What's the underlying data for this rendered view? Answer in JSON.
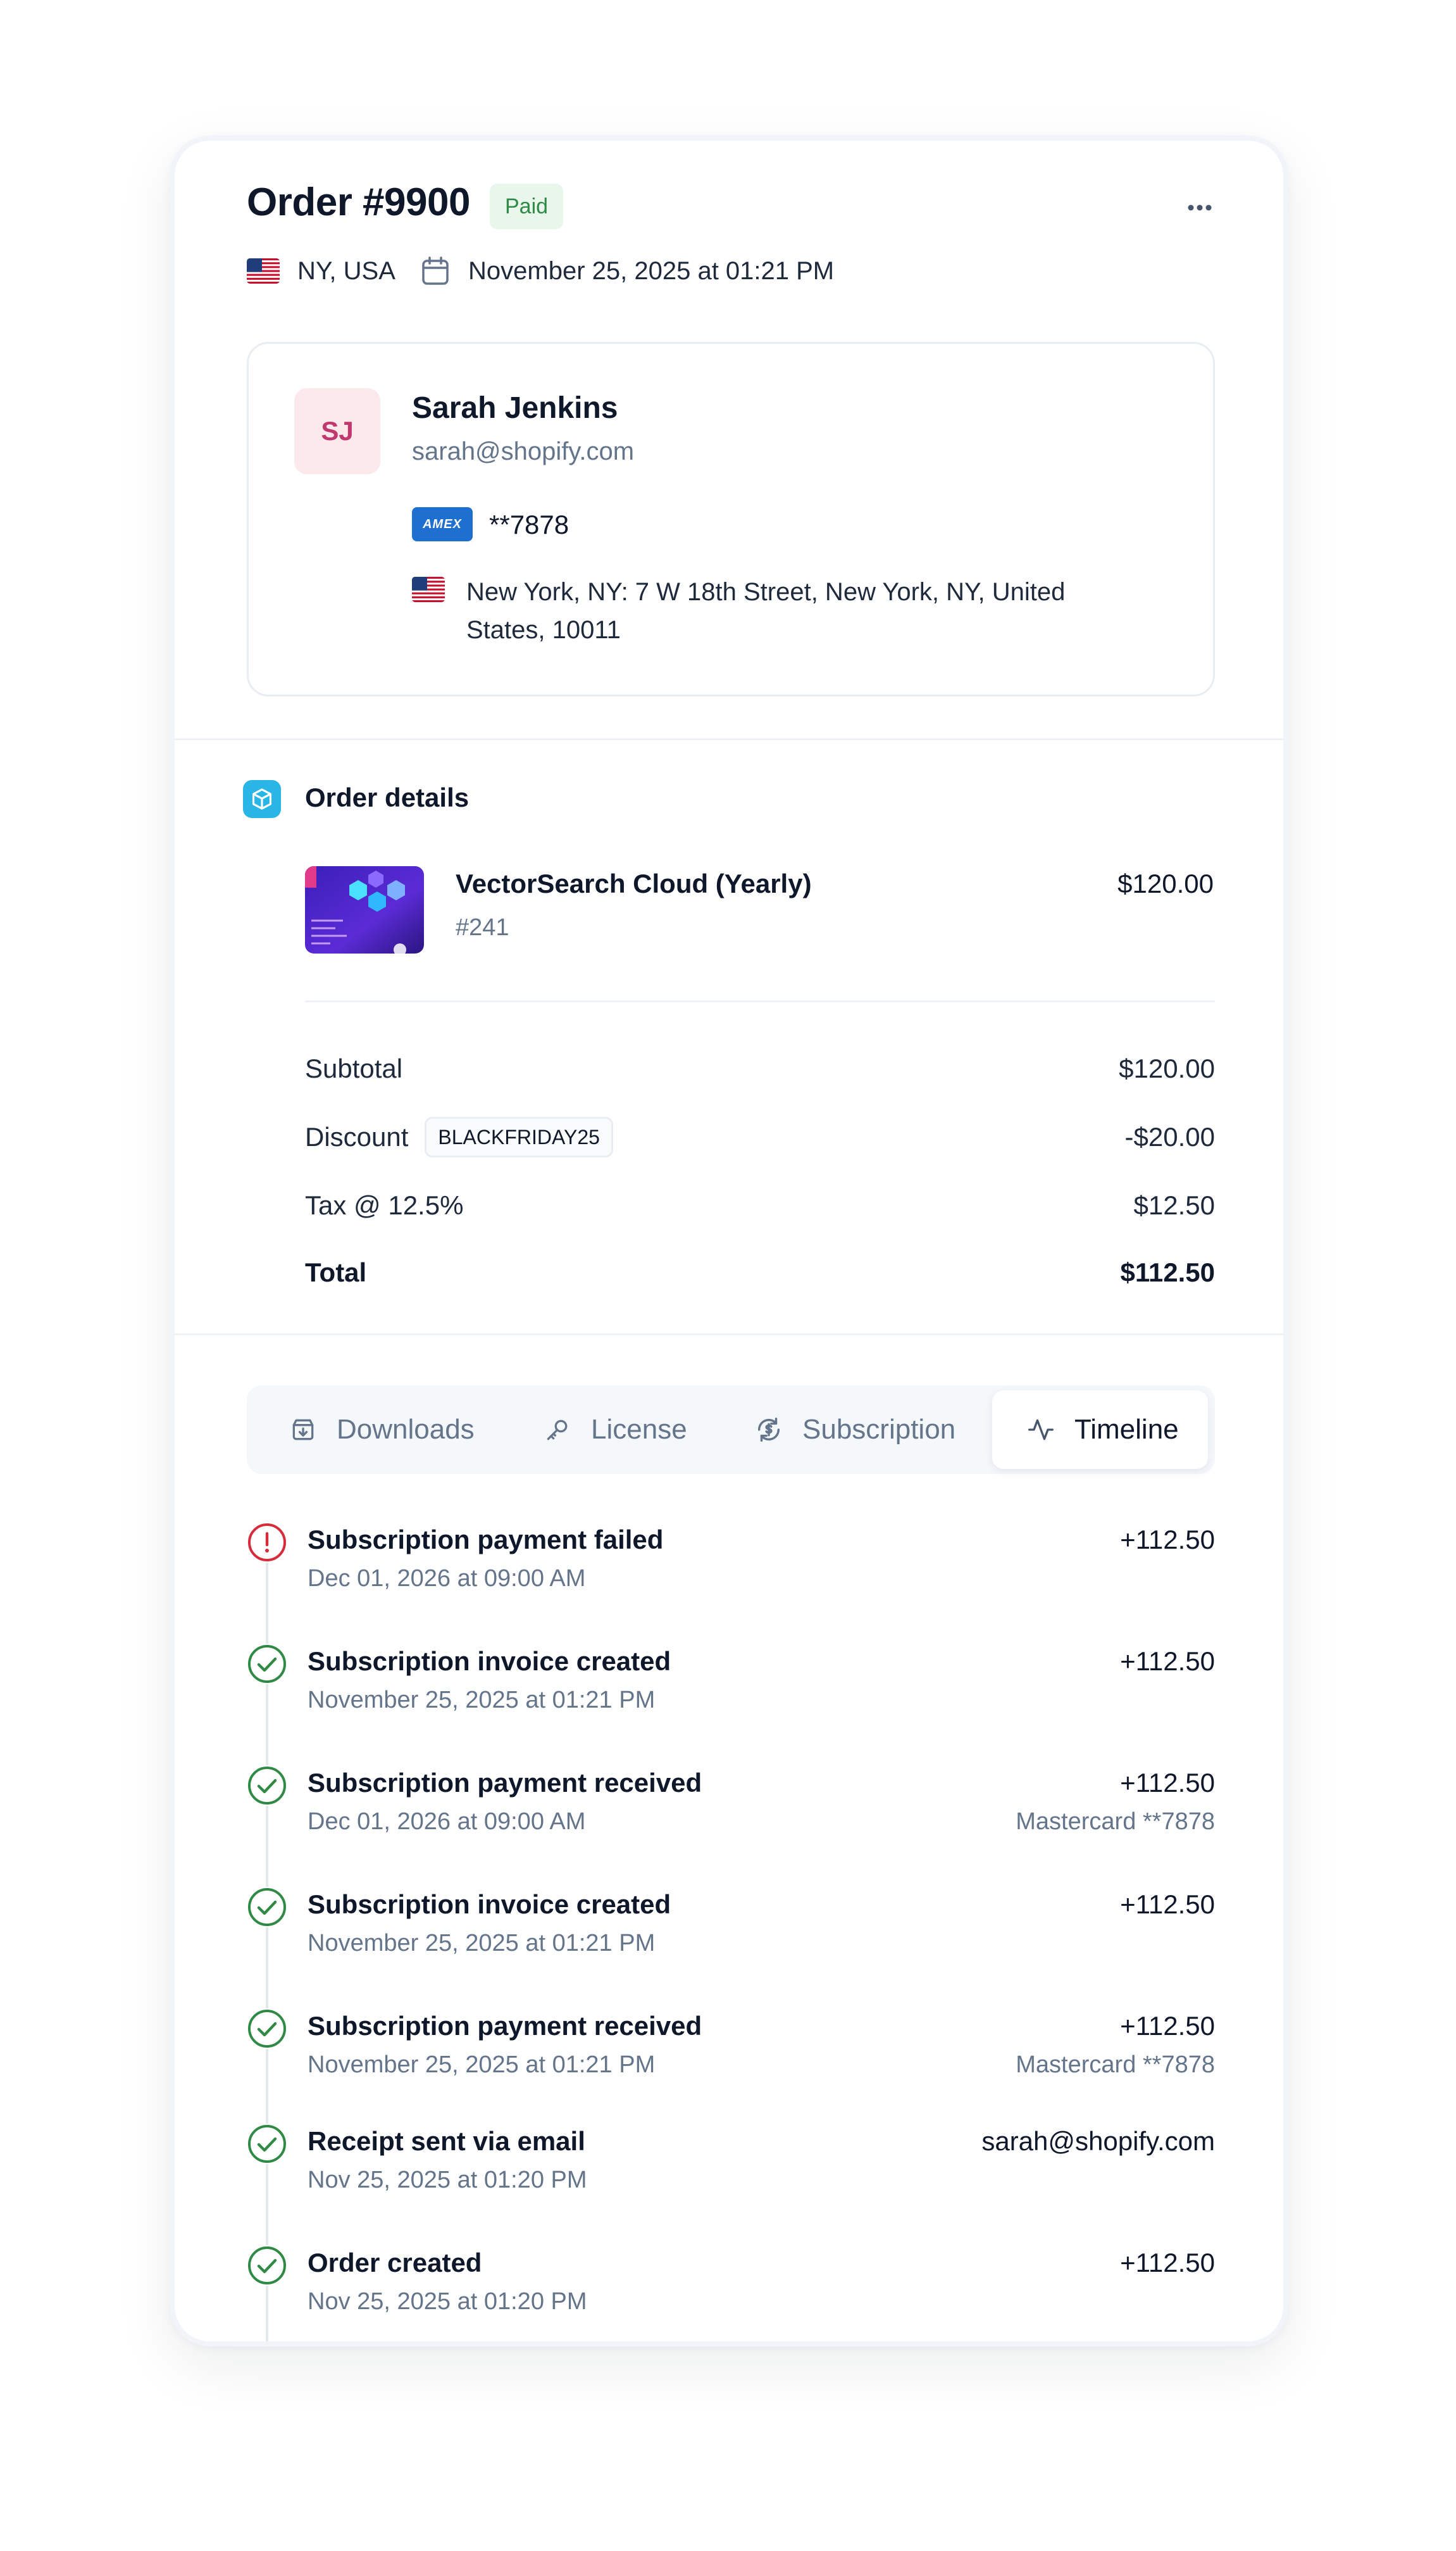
{
  "order": {
    "title": "Order #9900",
    "status": "Paid",
    "location": "NY, USA",
    "date": "November 25, 2025 at 01:21 PM"
  },
  "customer": {
    "initials": "SJ",
    "name": "Sarah Jenkins",
    "email": "sarah@shopify.com",
    "card_brand": "AMEX",
    "card_number": "**7878",
    "address": "New York, NY: 7 W 18th Street, New York, NY, United States, 10011"
  },
  "order_details": {
    "section_title": "Order details",
    "product": {
      "name": "VectorSearch Cloud (Yearly)",
      "id": "#241",
      "price": "$120.00"
    },
    "summary": {
      "subtotal_label": "Subtotal",
      "subtotal_value": "$120.00",
      "discount_label": "Discount",
      "discount_code": "BLACKFRIDAY25",
      "discount_value": "-$20.00",
      "tax_label": "Tax @ 12.5%",
      "tax_value": "$12.50",
      "total_label": "Total",
      "total_value": "$112.50"
    }
  },
  "tabs": [
    {
      "label": "Downloads",
      "icon": "download-icon",
      "active": false
    },
    {
      "label": "License",
      "icon": "key-icon",
      "active": false
    },
    {
      "label": "Subscription",
      "icon": "subscription-icon",
      "active": false
    },
    {
      "label": "Timeline",
      "icon": "activity-icon",
      "active": true
    }
  ],
  "timeline": [
    {
      "title": "Subscription payment failed",
      "time": "Dec 01, 2026 at 09:00 AM",
      "amount": "+112.50",
      "status": "error"
    },
    {
      "title": "Subscription invoice created",
      "time": "November 25, 2025 at 01:21 PM",
      "amount": "+112.50",
      "status": "success"
    },
    {
      "title": "Subscription payment received",
      "time": "Dec 01, 2026 at 09:00 AM",
      "amount": "+112.50",
      "sub": "Mastercard **7878",
      "status": "success"
    },
    {
      "title": "Subscription invoice created",
      "time": "November 25, 2025 at 01:21 PM",
      "amount": "+112.50",
      "status": "success"
    },
    {
      "title": "Subscription payment received",
      "time": "November 25, 2025 at 01:21 PM",
      "amount": "+112.50",
      "sub": "Mastercard **7878",
      "status": "success"
    },
    {
      "title": "Receipt sent via email",
      "time": "Nov 25, 2025 at 01:20 PM",
      "amount": "sarah@shopify.com",
      "status": "success"
    },
    {
      "title": "Order created",
      "time": "Nov 25, 2025 at 01:20 PM",
      "amount": "+112.50",
      "status": "success"
    }
  ],
  "colors": {
    "paid_badge_bg": "#e8f6ec",
    "paid_badge_text": "#2f8a46",
    "success": "#2f8a46",
    "error": "#d62b3b",
    "section_icon": "#29b6e6",
    "amex": "#1f6fd0"
  }
}
